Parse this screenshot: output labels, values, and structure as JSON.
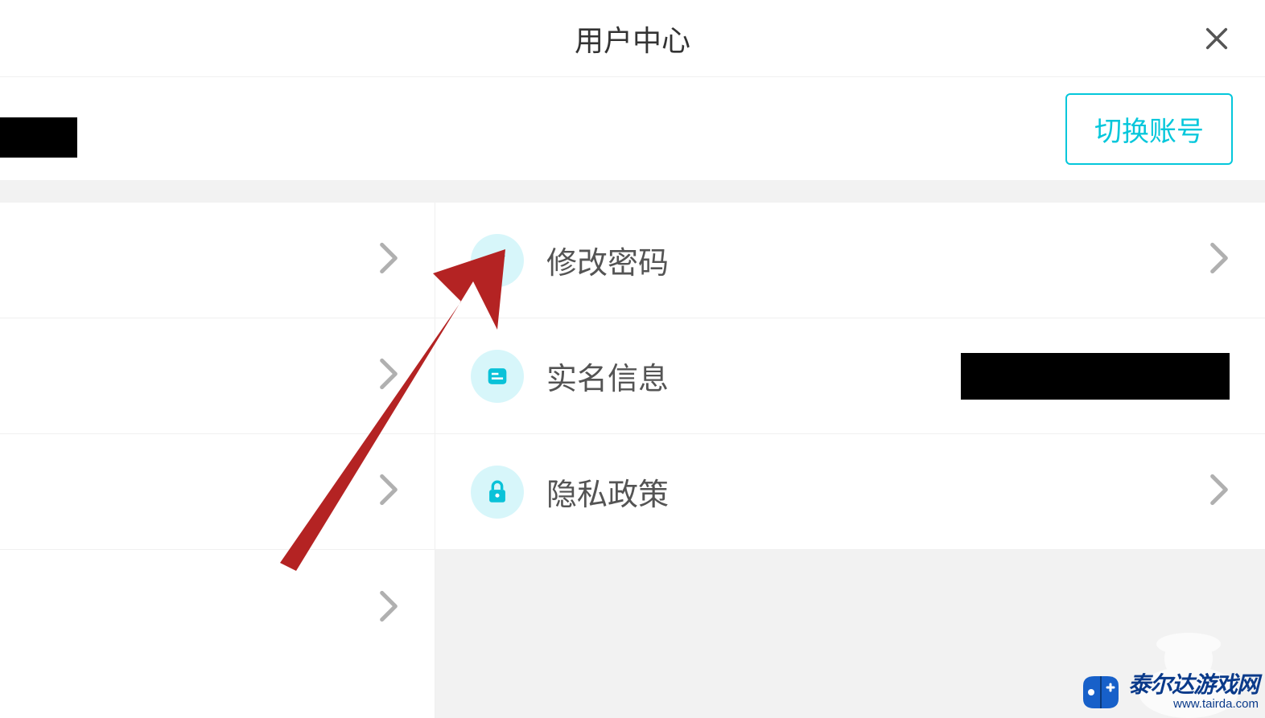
{
  "header": {
    "title": "用户中心"
  },
  "actions": {
    "switch_account": "切换账号"
  },
  "menu": {
    "change_password": "修改密码",
    "real_name_info": "实名信息",
    "privacy_policy": "隐私政策"
  },
  "watermark": {
    "title": "泰尔达游戏网",
    "url": "www.tairda.com"
  }
}
